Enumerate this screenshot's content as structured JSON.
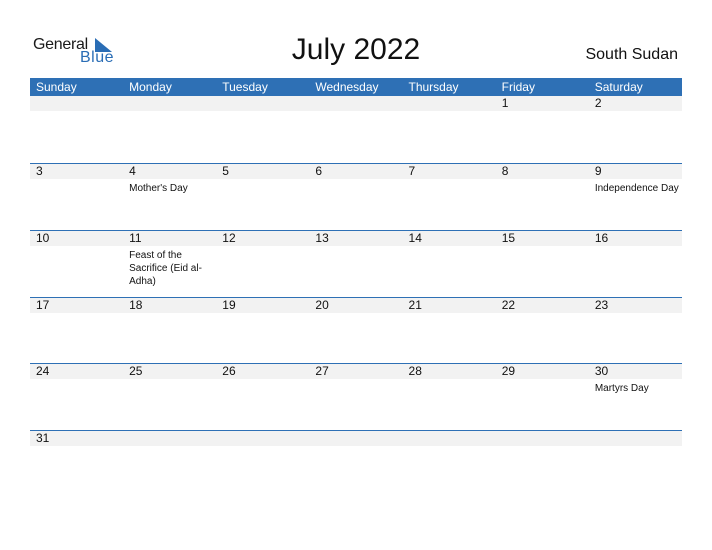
{
  "logo": {
    "general": "General",
    "blue": "Blue"
  },
  "title": "July 2022",
  "country": "South Sudan",
  "colors": {
    "accent": "#2e70b5",
    "strip": "#f2f2f2"
  },
  "weekdays": [
    "Sunday",
    "Monday",
    "Tuesday",
    "Wednesday",
    "Thursday",
    "Friday",
    "Saturday"
  ],
  "weeks": [
    [
      {
        "d": ""
      },
      {
        "d": ""
      },
      {
        "d": ""
      },
      {
        "d": ""
      },
      {
        "d": ""
      },
      {
        "d": "1"
      },
      {
        "d": "2"
      }
    ],
    [
      {
        "d": "3"
      },
      {
        "d": "4",
        "ev": "Mother's Day"
      },
      {
        "d": "5"
      },
      {
        "d": "6"
      },
      {
        "d": "7"
      },
      {
        "d": "8"
      },
      {
        "d": "9",
        "ev": "Independence Day"
      }
    ],
    [
      {
        "d": "10"
      },
      {
        "d": "11",
        "ev": "Feast of the Sacrifice (Eid al-Adha)"
      },
      {
        "d": "12"
      },
      {
        "d": "13"
      },
      {
        "d": "14"
      },
      {
        "d": "15"
      },
      {
        "d": "16"
      }
    ],
    [
      {
        "d": "17"
      },
      {
        "d": "18"
      },
      {
        "d": "19"
      },
      {
        "d": "20"
      },
      {
        "d": "21"
      },
      {
        "d": "22"
      },
      {
        "d": "23"
      }
    ],
    [
      {
        "d": "24"
      },
      {
        "d": "25"
      },
      {
        "d": "26"
      },
      {
        "d": "27"
      },
      {
        "d": "28"
      },
      {
        "d": "29"
      },
      {
        "d": "30",
        "ev": "Martyrs Day"
      }
    ],
    [
      {
        "d": "31"
      },
      {
        "d": ""
      },
      {
        "d": ""
      },
      {
        "d": ""
      },
      {
        "d": ""
      },
      {
        "d": ""
      },
      {
        "d": ""
      }
    ]
  ]
}
